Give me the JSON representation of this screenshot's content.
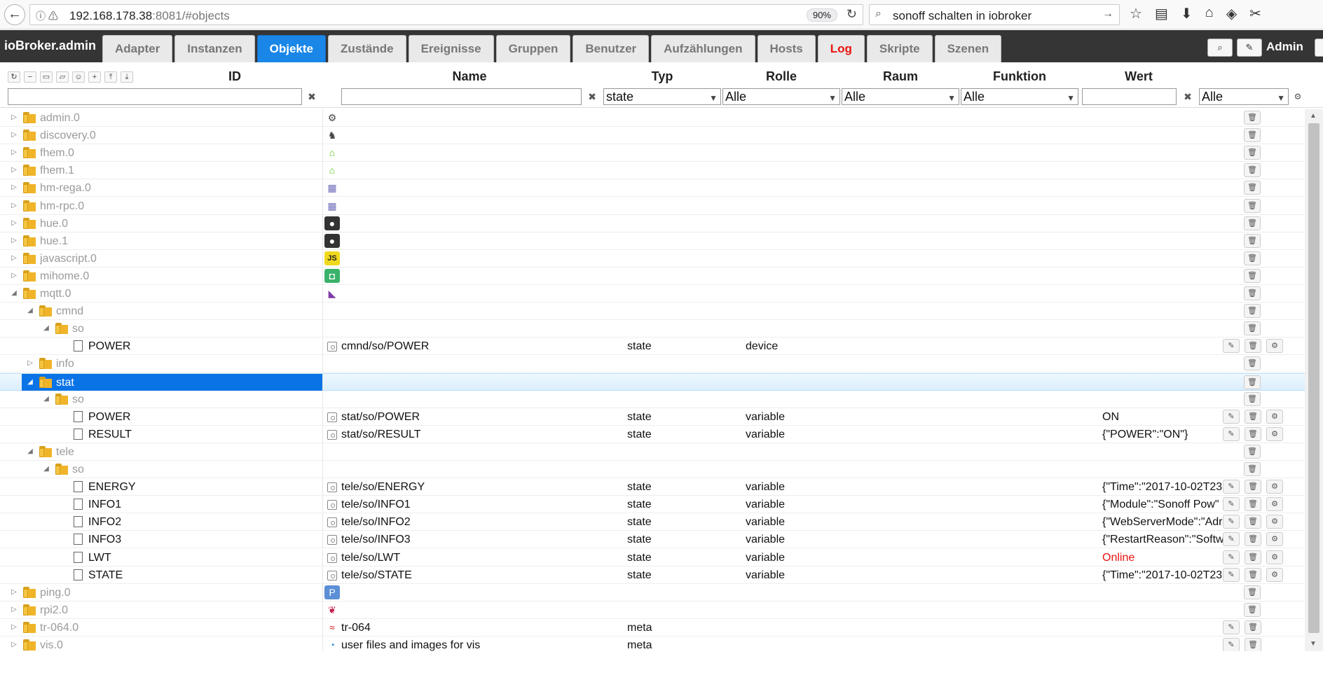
{
  "browser": {
    "url_host": "192.168.178.38",
    "url_rest": ":8081/#objects",
    "zoom": "90%",
    "search_text": "sonoff schalten in iobroker"
  },
  "app": {
    "brand": "ioBroker.admin",
    "tabs": [
      {
        "label": "Adapter"
      },
      {
        "label": "Instanzen"
      },
      {
        "label": "Objekte",
        "active": true
      },
      {
        "label": "Zustände"
      },
      {
        "label": "Ereignisse"
      },
      {
        "label": "Gruppen"
      },
      {
        "label": "Benutzer"
      },
      {
        "label": "Aufzählungen"
      },
      {
        "label": "Hosts"
      },
      {
        "label": "Log",
        "red": true
      },
      {
        "label": "Skripte"
      },
      {
        "label": "Szenen"
      }
    ],
    "user": "Admin"
  },
  "columns": {
    "id": "ID",
    "name": "Name",
    "type": "Typ",
    "role": "Rolle",
    "room": "Raum",
    "function": "Funktion",
    "value": "Wert"
  },
  "filters": {
    "id_value": "",
    "name_value": "",
    "type_selected": "state",
    "role_selected": "Alle",
    "room_selected": "Alle",
    "function_selected": "Alle",
    "value_value": "",
    "value_selected": "Alle"
  },
  "rows": [
    {
      "level": 0,
      "kind": "folder",
      "toggle": "collapsed",
      "id": "admin.0",
      "icon": "gear-icon",
      "icon_glyph": "⚙",
      "icon_color": "#444"
    },
    {
      "level": 0,
      "kind": "folder",
      "toggle": "collapsed",
      "id": "discovery.0",
      "icon": "binoculars-icon",
      "icon_glyph": "♞",
      "icon_color": "#444"
    },
    {
      "level": 0,
      "kind": "folder",
      "toggle": "collapsed",
      "id": "fhem.0",
      "icon": "fhem-house-icon",
      "icon_glyph": "⌂",
      "icon_color": "#56c91a"
    },
    {
      "level": 0,
      "kind": "folder",
      "toggle": "collapsed",
      "id": "fhem.1",
      "icon": "fhem-house-icon",
      "icon_glyph": "⌂",
      "icon_color": "#56c91a"
    },
    {
      "level": 0,
      "kind": "folder",
      "toggle": "collapsed",
      "id": "hm-rega.0",
      "icon": "homematic-icon",
      "icon_glyph": "▦",
      "icon_color": "#6b6bb8"
    },
    {
      "level": 0,
      "kind": "folder",
      "toggle": "collapsed",
      "id": "hm-rpc.0",
      "icon": "homematic-icon",
      "icon_glyph": "▦",
      "icon_color": "#6b6bb8"
    },
    {
      "level": 0,
      "kind": "folder",
      "toggle": "collapsed",
      "id": "hue.0",
      "icon": "hue-bulb-icon",
      "icon_glyph": "●",
      "icon_color": "#fff",
      "icon_bg": "#333"
    },
    {
      "level": 0,
      "kind": "folder",
      "toggle": "collapsed",
      "id": "hue.1",
      "icon": "hue-bulb-icon",
      "icon_glyph": "●",
      "icon_color": "#fff",
      "icon_bg": "#333"
    },
    {
      "level": 0,
      "kind": "folder",
      "toggle": "collapsed",
      "id": "javascript.0",
      "icon": "js-icon",
      "icon_glyph": "JS",
      "icon_color": "#222",
      "icon_bg": "#f0d91c"
    },
    {
      "level": 0,
      "kind": "folder",
      "toggle": "collapsed",
      "id": "mihome.0",
      "icon": "mihome-icon",
      "icon_glyph": "◘",
      "icon_color": "#fff",
      "icon_bg": "#3bb26a"
    },
    {
      "level": 0,
      "kind": "folder",
      "toggle": "expanded",
      "id": "mqtt.0",
      "icon": "mqtt-icon",
      "icon_glyph": "◣",
      "icon_color": "#7c3aa8"
    },
    {
      "level": 1,
      "kind": "folder",
      "toggle": "expanded",
      "id": "cmnd"
    },
    {
      "level": 2,
      "kind": "folder",
      "toggle": "expanded",
      "id": "so"
    },
    {
      "level": 3,
      "kind": "file",
      "id": "POWER",
      "state_icon": true,
      "name": "cmnd/so/POWER",
      "type": "state",
      "role": "device",
      "value": "",
      "actions": 3
    },
    {
      "level": 1,
      "kind": "folder",
      "toggle": "collapsed",
      "id": "info"
    },
    {
      "level": 1,
      "kind": "folder",
      "toggle": "expanded",
      "id": "stat",
      "selected": true
    },
    {
      "level": 2,
      "kind": "folder",
      "toggle": "expanded",
      "id": "so"
    },
    {
      "level": 3,
      "kind": "file",
      "id": "POWER",
      "state_icon": true,
      "name": "stat/so/POWER",
      "type": "state",
      "role": "variable",
      "value": "ON",
      "actions": 3
    },
    {
      "level": 3,
      "kind": "file",
      "id": "RESULT",
      "state_icon": true,
      "name": "stat/so/RESULT",
      "type": "state",
      "role": "variable",
      "value": "{\"POWER\":\"ON\"}",
      "actions": 3
    },
    {
      "level": 1,
      "kind": "folder",
      "toggle": "expanded",
      "id": "tele"
    },
    {
      "level": 2,
      "kind": "folder",
      "toggle": "expanded",
      "id": "so"
    },
    {
      "level": 3,
      "kind": "file",
      "id": "ENERGY",
      "state_icon": true,
      "name": "tele/so/ENERGY",
      "type": "state",
      "role": "variable",
      "value": "{\"Time\":\"2017-10-02T23",
      "actions": 3
    },
    {
      "level": 3,
      "kind": "file",
      "id": "INFO1",
      "state_icon": true,
      "name": "tele/so/INFO1",
      "type": "state",
      "role": "variable",
      "value": "{\"Module\":\"Sonoff Pow\"",
      "actions": 3
    },
    {
      "level": 3,
      "kind": "file",
      "id": "INFO2",
      "state_icon": true,
      "name": "tele/so/INFO2",
      "type": "state",
      "role": "variable",
      "value": "{\"WebServerMode\":\"Adr",
      "actions": 3
    },
    {
      "level": 3,
      "kind": "file",
      "id": "INFO3",
      "state_icon": true,
      "name": "tele/so/INFO3",
      "type": "state",
      "role": "variable",
      "value": "{\"RestartReason\":\"Softw",
      "actions": 3
    },
    {
      "level": 3,
      "kind": "file",
      "id": "LWT",
      "state_icon": true,
      "name": "tele/so/LWT",
      "type": "state",
      "role": "variable",
      "value": "Online",
      "value_red": true,
      "actions": 3
    },
    {
      "level": 3,
      "kind": "file",
      "id": "STATE",
      "state_icon": true,
      "name": "tele/so/STATE",
      "type": "state",
      "role": "variable",
      "value": "{\"Time\":\"2017-10-02T23",
      "actions": 3
    },
    {
      "level": 0,
      "kind": "folder",
      "toggle": "collapsed",
      "id": "ping.0",
      "icon": "ping-icon",
      "icon_glyph": "P",
      "icon_color": "#fff",
      "icon_bg": "#5b8fd6"
    },
    {
      "level": 0,
      "kind": "folder",
      "toggle": "collapsed",
      "id": "rpi2.0",
      "icon": "raspberry-icon",
      "icon_glyph": "❦",
      "icon_color": "#c51a4a"
    },
    {
      "level": 0,
      "kind": "folder",
      "toggle": "collapsed",
      "id": "tr-064.0",
      "icon": "fritzbox-icon",
      "icon_glyph": "≈",
      "icon_color": "#d2151b",
      "name": "tr-064",
      "type": "meta",
      "actions": 2
    },
    {
      "level": 0,
      "kind": "folder",
      "toggle": "collapsed",
      "id": "vis.0",
      "icon": "vis-icon",
      "icon_glyph": "◔",
      "icon_color": "#3a8fd6",
      "name": "user files and images for vis",
      "type": "meta",
      "actions": 2
    }
  ]
}
